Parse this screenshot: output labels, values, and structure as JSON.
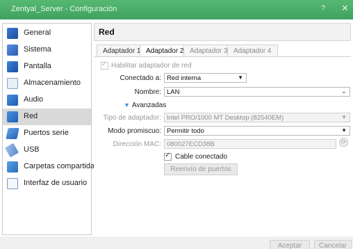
{
  "window": {
    "title": "Zentyal_Server - Configuración",
    "help_label": "?",
    "close_label": "✕"
  },
  "sidebar": {
    "items": [
      {
        "label": "General",
        "icon": "general-icon"
      },
      {
        "label": "Sistema",
        "icon": "motherboard-icon"
      },
      {
        "label": "Pantalla",
        "icon": "display-icon"
      },
      {
        "label": "Almacenamiento",
        "icon": "storage-icon"
      },
      {
        "label": "Audio",
        "icon": "audio-icon"
      },
      {
        "label": "Red",
        "icon": "network-icon",
        "selected": true
      },
      {
        "label": "Puertos serie",
        "icon": "serial-port-icon"
      },
      {
        "label": "USB",
        "icon": "usb-icon"
      },
      {
        "label": "Carpetas compartidas",
        "icon": "shared-folder-icon"
      },
      {
        "label": "Interfaz de usuario",
        "icon": "user-interface-icon"
      }
    ]
  },
  "header": {
    "title": "Red"
  },
  "tabs": [
    {
      "label": "Adaptador 1",
      "active": false
    },
    {
      "label": "Adaptador 2",
      "active": true
    },
    {
      "label": "Adaptador 3",
      "active": false
    },
    {
      "label": "Adaptador 4",
      "active": false
    }
  ],
  "adapter": {
    "enable_label": "Habilitar adaptador de red",
    "enable_checked": true,
    "attached_label": "Conectado a:",
    "attached_value": "Red interna",
    "name_label": "Nombre:",
    "name_value": "LAN",
    "advanced_label": "Avanzadas",
    "type_label": "Tipo de adaptador:",
    "type_value": "Intel PRO/1000 MT Desktop (82540EM)",
    "promisc_label": "Modo promiscuo:",
    "promisc_value": "Permitir todo",
    "mac_label": "Dirección MAC:",
    "mac_value": "080027ECD38B",
    "cable_label": "Cable conectado",
    "cable_checked": true,
    "port_forward_label": "Reenvío de puertos"
  },
  "footer": {
    "accept_label": "Aceptar",
    "cancel_label": "Cancelar"
  },
  "colors": {
    "titlebar": "#3ea25e",
    "selected_item": "#d9d9d9",
    "accent_triangle": "#3a8ee6"
  }
}
